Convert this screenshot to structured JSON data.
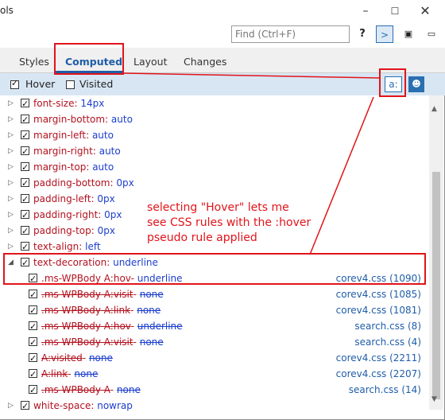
{
  "window": {
    "title_fragment": "ols",
    "minimize_glyph": "–",
    "maximize_glyph": "☐",
    "close_glyph": "✕"
  },
  "toolbar": {
    "find_placeholder": "Find (Ctrl+F)",
    "help_label": "?",
    "console_icon": "console-icon",
    "dock_icon": "dock-icon",
    "pin_icon": "pin-icon"
  },
  "tabs": [
    {
      "label": "Styles"
    },
    {
      "label": "Computed"
    },
    {
      "label": "Layout"
    },
    {
      "label": "Changes"
    }
  ],
  "state": {
    "hover_label": "Hover",
    "hover_checked": true,
    "visited_label": "Visited",
    "visited_checked": false,
    "pseudo_button_label": "a:",
    "user_button_label": "☻"
  },
  "properties": [
    {
      "name": "font-size",
      "value": "14px"
    },
    {
      "name": "margin-bottom",
      "value": "auto"
    },
    {
      "name": "margin-left",
      "value": "auto"
    },
    {
      "name": "margin-right",
      "value": "auto"
    },
    {
      "name": "margin-top",
      "value": "auto"
    },
    {
      "name": "padding-bottom",
      "value": "0px"
    },
    {
      "name": "padding-left",
      "value": "0px"
    },
    {
      "name": "padding-right",
      "value": "0px"
    },
    {
      "name": "padding-top",
      "value": "0px"
    },
    {
      "name": "text-align",
      "value": "left"
    },
    {
      "name": "text-decoration",
      "value": "underline"
    }
  ],
  "text_decoration_rules": [
    {
      "selector": ".ms-WPBody A:hov",
      "value": "underline",
      "source": "corev4.css (1090)",
      "overridden": false
    },
    {
      "selector": ".ms-WPBody A:visit",
      "value": "none",
      "source": "corev4.css (1085)",
      "overridden": true
    },
    {
      "selector": ".ms-WPBody A:link",
      "value": "none",
      "source": "corev4.css (1081)",
      "overridden": true
    },
    {
      "selector": ".ms-WPBody A:hov",
      "value": "underline",
      "source": "search.css (8)",
      "overridden": true
    },
    {
      "selector": ".ms-WPBody A:visit",
      "value": "none",
      "source": "search.css (4)",
      "overridden": true
    },
    {
      "selector": "A:visited",
      "value": "none",
      "source": "corev4.css (2211)",
      "overridden": true
    },
    {
      "selector": "A:link",
      "value": "none",
      "source": "corev4.css (2207)",
      "overridden": true
    },
    {
      "selector": ".ms-WPBody A",
      "value": "none",
      "source": "search.css (14)",
      "overridden": true
    }
  ],
  "last_property": {
    "name": "white-space",
    "value": "nowrap"
  },
  "annotation": {
    "text_line1": "selecting \"Hover\" lets me",
    "text_line2": "see CSS rules with the :hover",
    "text_line3": "pseudo rule applied",
    "color": "#e1141a"
  }
}
